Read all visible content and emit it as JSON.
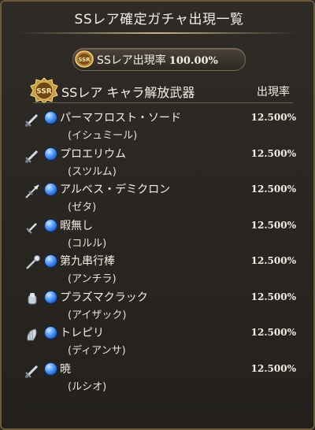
{
  "window": {
    "title": "SSレア確定ガチャ出現一覧"
  },
  "summary": {
    "label": "SSレア出現率",
    "rate": "100.00%"
  },
  "section": {
    "title": "SSレア キャラ解放武器",
    "rate_header": "出現率",
    "badge_text": "SSR"
  },
  "items": [
    {
      "weapon": "パーマフロスト・ソード",
      "character": "(イシュミール)",
      "rate": "12.500%",
      "icon": "sword-icon"
    },
    {
      "weapon": "プロエリウム",
      "character": "(スツルム)",
      "rate": "12.500%",
      "icon": "sword-icon"
    },
    {
      "weapon": "アルベス・デミクロン",
      "character": "(ゼタ)",
      "rate": "12.500%",
      "icon": "spear-icon"
    },
    {
      "weapon": "暇無し",
      "character": "(コルル)",
      "rate": "12.500%",
      "icon": "dagger-icon"
    },
    {
      "weapon": "第九串行棒",
      "character": "(アンチラ)",
      "rate": "12.500%",
      "icon": "staff-icon"
    },
    {
      "weapon": "プラズマクラック",
      "character": "(アイザック)",
      "rate": "12.500%",
      "icon": "gauntlet-icon"
    },
    {
      "weapon": "トレピリ",
      "character": "(ディアンサ)",
      "rate": "12.500%",
      "icon": "harp-icon"
    },
    {
      "weapon": "暁",
      "character": "(ルシオ)",
      "rate": "12.500%",
      "icon": "sword-icon"
    }
  ],
  "colors": {
    "element_water": "#3f86ee",
    "gold": "#c9a24a",
    "text": "#f4efe5"
  }
}
